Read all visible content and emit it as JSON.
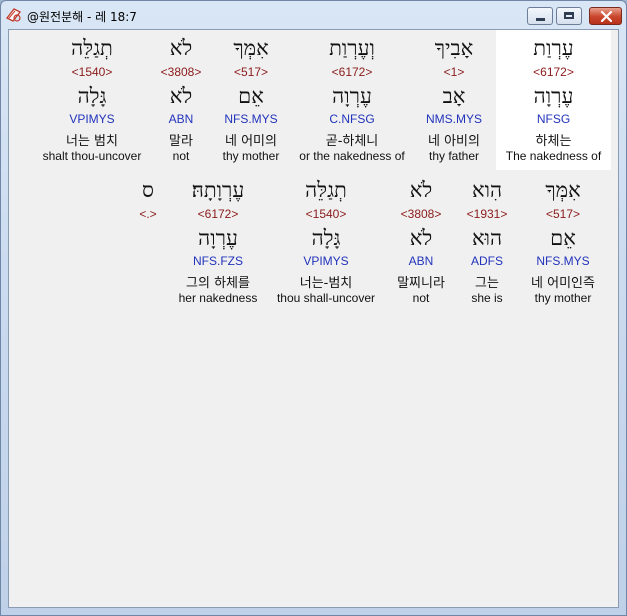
{
  "window": {
    "title": "@원전분해 - 레 18:7",
    "icon": "bible-app-icon"
  },
  "rows": [
    {
      "words": [
        {
          "surface": "עֶרְוַת",
          "strong": "<6172>",
          "lemma": "עֶרְוָה",
          "morph": "NFSG",
          "korean": "하체는",
          "english": "The nakedness of",
          "selected": true
        },
        {
          "surface": "אָבִיךָ",
          "strong": "<1>",
          "lemma": "אָב",
          "morph": "NMS.MYS",
          "korean": "네 아비의",
          "english": "thy father",
          "selected": false
        },
        {
          "surface": "וְעֶרְוַת",
          "strong": "<6172>",
          "lemma": "עֶרְוָה",
          "morph": "C.NFSG",
          "korean": "곧-하체니",
          "english": "or the nakedness of",
          "selected": false
        },
        {
          "surface": "אִמְּךָ",
          "strong": "<517>",
          "lemma": "אֵם",
          "morph": "NFS.MYS",
          "korean": "네 어미의",
          "english": "thy mother",
          "selected": false
        },
        {
          "surface": "לֹא",
          "strong": "<3808>",
          "lemma": "לֹא",
          "morph": "ABN",
          "korean": "말라",
          "english": "not",
          "selected": false
        },
        {
          "surface": "תְגַלֵּה",
          "strong": "<1540>",
          "lemma": "גָּלָה",
          "morph": "VPIMYS",
          "korean": "너는 범치",
          "english": "shalt thou-uncover",
          "selected": false
        }
      ]
    },
    {
      "words": [
        {
          "surface": "אִמְּךָ",
          "strong": "<517>",
          "lemma": "אֵם",
          "morph": "NFS.MYS",
          "korean": "네 어미인즉",
          "english": "thy mother",
          "selected": false
        },
        {
          "surface": "הִוא",
          "strong": "<1931>",
          "lemma": "הוּא",
          "morph": "ADFS",
          "korean": "그는",
          "english": "she is",
          "selected": false
        },
        {
          "surface": "לֹא",
          "strong": "<3808>",
          "lemma": "לֹא",
          "morph": "ABN",
          "korean": "말찌니라",
          "english": "not",
          "selected": false
        },
        {
          "surface": "תְגַלֵּה",
          "strong": "<1540>",
          "lemma": "גָּלָה",
          "morph": "VPIMYS",
          "korean": "너는-범치",
          "english": "thou shall-uncover",
          "selected": false
        },
        {
          "surface": "עֶרְוָתָהּ׃",
          "strong": "<6172>",
          "lemma": "עֶרְוָה",
          "morph": "NFS.FZS",
          "korean": "그의 하체를",
          "english": "her nakedness",
          "selected": false
        },
        {
          "surface": "ס",
          "strong": "<.>",
          "lemma": "",
          "morph": "",
          "korean": "",
          "english": "",
          "selected": false
        }
      ]
    }
  ]
}
